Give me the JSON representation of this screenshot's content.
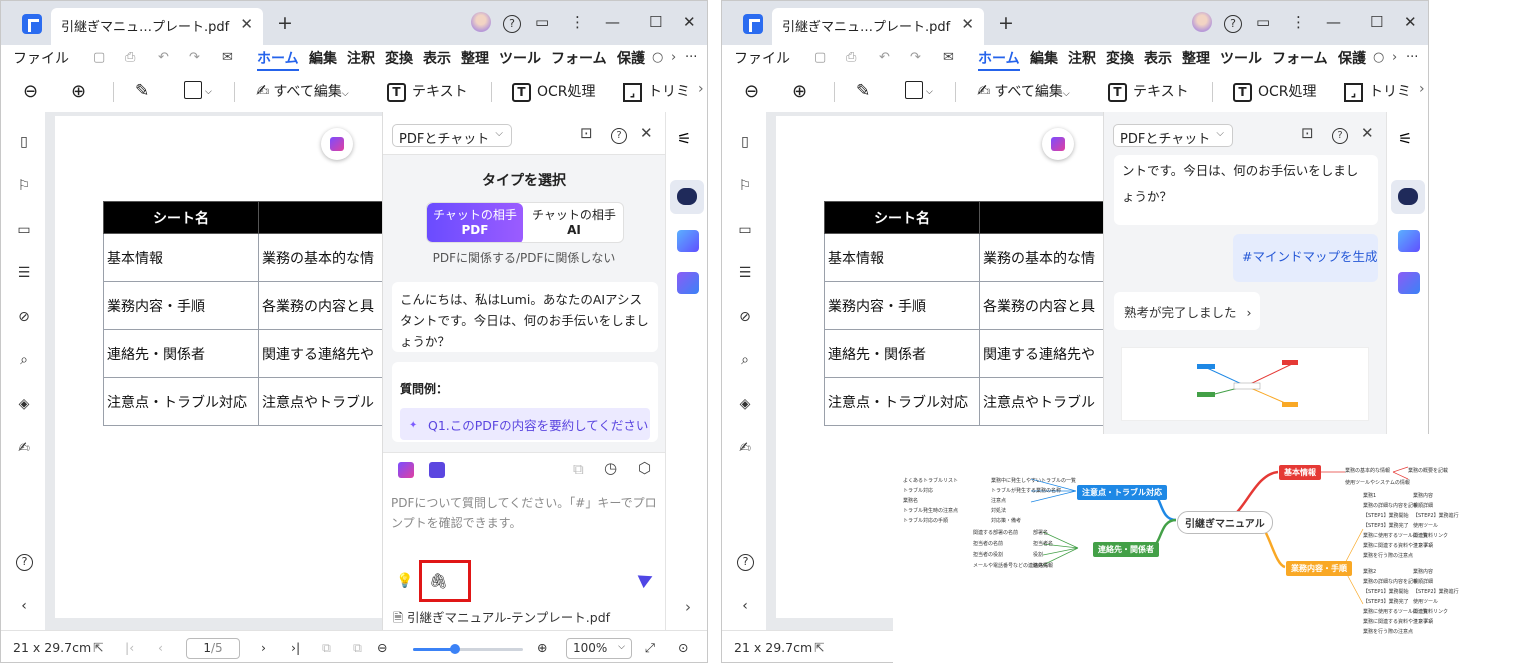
{
  "left": {
    "tab_title": "引継ぎマニュ…プレート.pdf",
    "menu": [
      "ファイル",
      "ホーム",
      "編集",
      "注釈",
      "変換",
      "表示",
      "整理",
      "ツール",
      "フォーム",
      "保護"
    ],
    "toolbar": {
      "edit_all": "すべて編集",
      "text": "テキスト",
      "ocr": "OCR処理",
      "trim": "トリミ"
    },
    "table": {
      "header": "シート名",
      "rows": [
        [
          "基本情報",
          "業務の基本的な情"
        ],
        [
          "業務内容・手順",
          "各業務の内容と具"
        ],
        [
          "連絡先・関係者",
          "関連する連絡先や"
        ],
        [
          "注意点・トラブル対応",
          "注意点やトラブル"
        ]
      ]
    },
    "ai": {
      "mode": "PDFとチャット",
      "type_title": "タイプを選択",
      "seg_a_line1": "チャットの相手",
      "seg_a_line2": "PDF",
      "seg_b_line1": "チャットの相手",
      "seg_b_line2": "AI",
      "seg_sub": "PDFに関係する/PDFに関係しない",
      "greeting": "こんにちは、私はLumi。あなたのAIアシスタントです。今日は、何のお手伝いをしましょうか？",
      "examples_label": "質問例：",
      "example_1": "Q1.このPDFの内容を要約してください",
      "placeholder": "PDFについて質問してください。「#」キーでプロンプトを確認できます。",
      "file_name": "引継ぎマニュアル-テンプレート.pdf"
    },
    "status": {
      "size": "21 x 29.7cm",
      "page": "1",
      "page_total": "/5",
      "zoom": "100%",
      "zoom_fraction": 0.38
    }
  },
  "right": {
    "tab_title": "引継ぎマニュ…プレート.pdf",
    "chat_tail": "ントです。今日は、何のお手伝いをしましょうか？",
    "user_msg": "#マインドマップを生成",
    "thinking": "熟考が完了しました",
    "status": {
      "size": "21 x 29.7cm"
    }
  },
  "mindmap": {
    "center": "引継ぎマニュアル",
    "branches": [
      {
        "label": "基本情報",
        "color": "#e53935"
      },
      {
        "label": "業務内容・手順",
        "color": "#f9a825"
      },
      {
        "label": "注意点・トラブル対応",
        "color": "#1e88e5"
      },
      {
        "label": "連絡先・関係者",
        "color": "#43a047"
      }
    ],
    "leaves_basic": [
      "業務の基本的な情報",
      "業務の概要を記載",
      "使用ツールやシステムの情報"
    ],
    "leaves_trouble": [
      "よくあるトラブルリスト",
      "業務中に発生しやすいトラブルの一覧",
      "トラブル対応",
      "トラブルが発生する業務の名称",
      "業務名",
      "注意点",
      "トラブル発生時の注意点",
      "対処法",
      "トラブル対応の手順",
      "対応策・備考"
    ],
    "leaves_contact": [
      "関連する部署の名前",
      "部署名",
      "担当者の名前",
      "担当者名",
      "担当者の役割",
      "役割",
      "メールや電話番号などの連絡先情報",
      "連絡先"
    ],
    "leaves_steps": [
      "業務1",
      "業務内容",
      "業務の詳細な内容を記載",
      "手順詳細",
      "【STEP1】業務開始",
      "【STEP2】業務進行",
      "【STEP3】業務完了",
      "使用ツール",
      "業務に使用するツールの一覧",
      "関連資料リンク",
      "業務に関連する資料やテンプレ",
      "注意事項",
      "業務を行う際の注意点",
      "業務2",
      "業務内容",
      "業務の詳細な内容を記載",
      "手順詳細",
      "【STEP1】業務開始",
      "【STEP2】業務進行",
      "【STEP3】業務完了",
      "使用ツール",
      "業務に使用するツールの一覧",
      "関連資料リンク",
      "業務に関連する資料やテンプレ",
      "注意事項",
      "業務を行う際の注意点"
    ]
  }
}
